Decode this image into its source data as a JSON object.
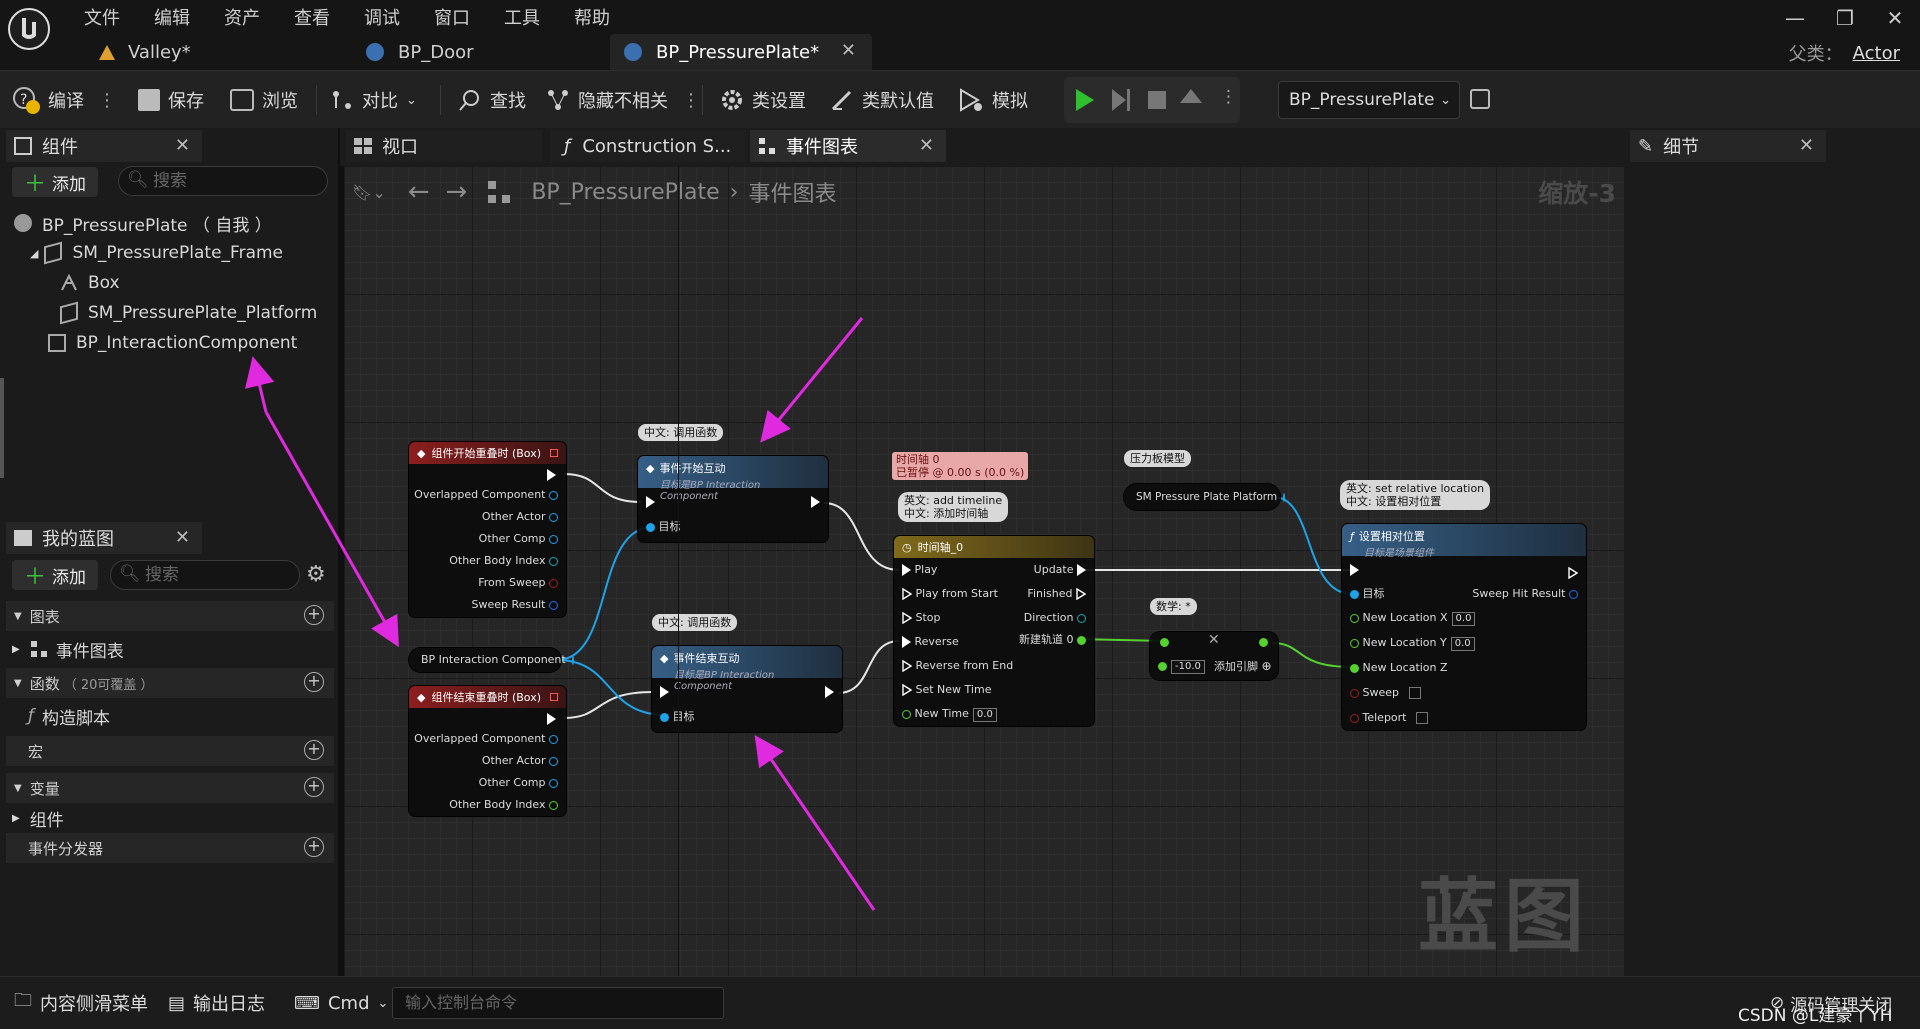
{
  "menu": [
    "文件",
    "编辑",
    "资产",
    "查看",
    "调试",
    "窗口",
    "工具",
    "帮助"
  ],
  "doc_tabs": [
    "Valley*",
    "BP_Door",
    "BP_PressurePlate*"
  ],
  "parent_label": "父类：",
  "parent_value": "Actor",
  "toolbar": {
    "compile": "编译",
    "save": "保存",
    "browse": "浏览",
    "diff": "对比",
    "find": "查找",
    "hide_unrelated": "隐藏不相关",
    "class_settings": "类设置",
    "class_defaults": "类默认值",
    "simulate": "模拟",
    "debug_target": "BP_PressurePlate"
  },
  "components_panel": {
    "title": "组件",
    "add": "添加",
    "search_placeholder": "搜索",
    "items": [
      "BP_PressurePlate （ 自我 ）",
      "SM_PressurePlate_Frame",
      "Box",
      "SM_PressurePlate_Platform",
      "BP_InteractionComponent"
    ]
  },
  "my_blueprint": {
    "title": "我的蓝图",
    "add": "添加",
    "search_placeholder": "搜索",
    "sections": {
      "graphs": "图表",
      "event_graph": "事件图表",
      "functions": "函数",
      "functions_note": "（ 20可覆盖 ）",
      "construction_script": "构造脚本",
      "macros": "宏",
      "variables": "变量",
      "components": "组件",
      "event_dispatchers": "事件分发器"
    }
  },
  "editor_tabs": [
    "视口",
    "Construction S...",
    "事件图表"
  ],
  "breadcrumb": {
    "root": "BP_PressurePlate",
    "current": "事件图表"
  },
  "zoom": "缩放-3",
  "watermark": "蓝图",
  "details": {
    "title": "细节"
  },
  "nodes": {
    "begin_overlap": {
      "title": "组件开始重叠时 (Box)",
      "pins": [
        "Overlapped Component",
        "Other Actor",
        "Other Comp",
        "Other Body Index",
        "From Sweep",
        "Sweep Result"
      ]
    },
    "interaction_var": {
      "label": "BP Interaction Component"
    },
    "end_overlap": {
      "title": "组件结束重叠时 (Box)",
      "pins": [
        "Overlapped Component",
        "Other Actor",
        "Other Comp",
        "Other Body Index"
      ]
    },
    "start_interact": {
      "comment": "中文: 调用函数",
      "title": "事件开始互动",
      "subtitle": "目标是BP Interaction Component",
      "target": "目标"
    },
    "end_interact": {
      "comment": "中文: 调用函数",
      "title": "事件结束互动",
      "subtitle": "目标是BP Interaction Component",
      "target": "目标"
    },
    "timeline": {
      "status_line1": "时间轴 0",
      "status_line2": "已暂停 @ 0.00 s (0.0 %)",
      "comment_line1": "英文: add timeline",
      "comment_line2": "中文: 添加时间轴",
      "title": "时间轴_0",
      "inputs": [
        "Play",
        "Play from Start",
        "Stop",
        "Reverse",
        "Reverse from End",
        "Set New Time",
        "New Time"
      ],
      "new_time_value": "0.0",
      "outputs": [
        "Update",
        "Finished",
        "Direction",
        "新建轨道 0"
      ]
    },
    "platform_var": {
      "comment": "压力板模型",
      "label": "SM Pressure Plate Platform"
    },
    "multiply": {
      "comment": "数学: *",
      "value": "-10.0",
      "add_pin": "添加引脚"
    },
    "set_location": {
      "comment_line1": "英文: set relative location",
      "comment_line2": "中文: 设置相对位置",
      "title": "设置相对位置",
      "subtitle": "目标是场景组件",
      "inputs": [
        "目标",
        "New Location X",
        "New Location Y",
        "New Location Z",
        "Sweep",
        "Teleport"
      ],
      "x_value": "0.0",
      "y_value": "0.0",
      "output": "Sweep Hit Result"
    }
  },
  "bottom": {
    "content_drawer": "内容侧滑菜单",
    "output_log": "输出日志",
    "cmd": "Cmd",
    "console_placeholder": "输入控制台命令",
    "source_control": "源码管理关闭",
    "credit": "CSDN @L建豪丫YH"
  },
  "colors": {
    "annotation_arrow": "#e02ae0",
    "exec_wire": "#e6e6e6",
    "object_pin": "#1fa3e8",
    "float_pin": "#55d130",
    "bool_pin": "#9c1c1c",
    "struct_pin": "#1aa5b5"
  }
}
